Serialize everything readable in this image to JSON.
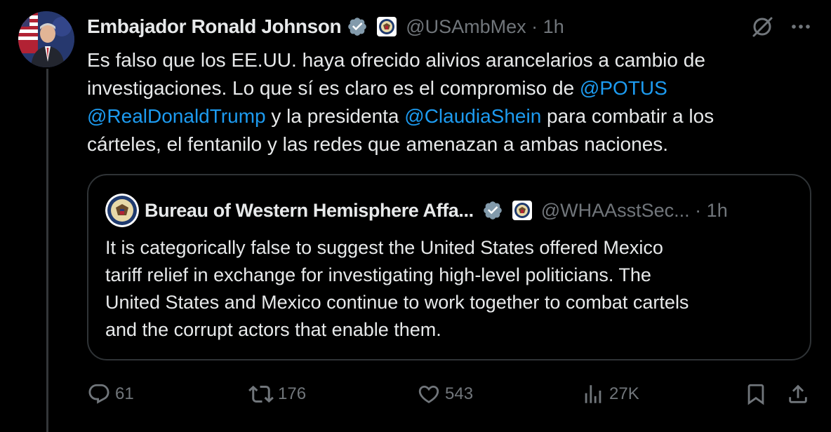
{
  "post": {
    "author_name": "Embajador Ronald Johnson",
    "author_handle": "@USAmbMex",
    "time": "1h",
    "text_lines": [
      [
        {
          "t": "Es falso que los EE.UU. haya ofrecido alivios arancelarios a cambio de"
        }
      ],
      [
        {
          "t": "investigaciones. Lo que sí es claro es el compromiso de "
        },
        {
          "t": "@POTUS",
          "m": true
        }
      ],
      [
        {
          "t": "@RealDonaldTrump",
          "m": true
        },
        {
          "t": " y la presidenta "
        },
        {
          "t": "@ClaudiaShein",
          "m": true
        },
        {
          "t": " para combatir a los"
        }
      ],
      [
        {
          "t": "cárteles, el fentanilo y las redes que amenazan a ambas naciones."
        }
      ]
    ]
  },
  "quote": {
    "author_name": "Bureau of Western Hemisphere Affa...",
    "author_handle": "@WHAAsstSec...",
    "time": "1h",
    "text_lines": [
      "It is categorically false to suggest the United States offered Mexico",
      "tariff relief in exchange for investigating high-level politicians. The",
      "United States and Mexico continue to work together to combat cartels",
      "and the corrupt actors that enable them."
    ]
  },
  "actions": {
    "replies": "61",
    "reposts": "176",
    "likes": "543",
    "views": "27K"
  },
  "colors": {
    "background": "#000000",
    "text": "#e7e9ea",
    "secondary": "#71767b",
    "mention": "#1d9bf0",
    "border": "#2f3336",
    "verified": "#829aab"
  },
  "icons": [
    "verified-badge-icon",
    "government-seal-icon",
    "grok-icon",
    "more-icon",
    "reply-icon",
    "repost-icon",
    "like-icon",
    "views-icon",
    "bookmark-icon",
    "share-icon"
  ]
}
